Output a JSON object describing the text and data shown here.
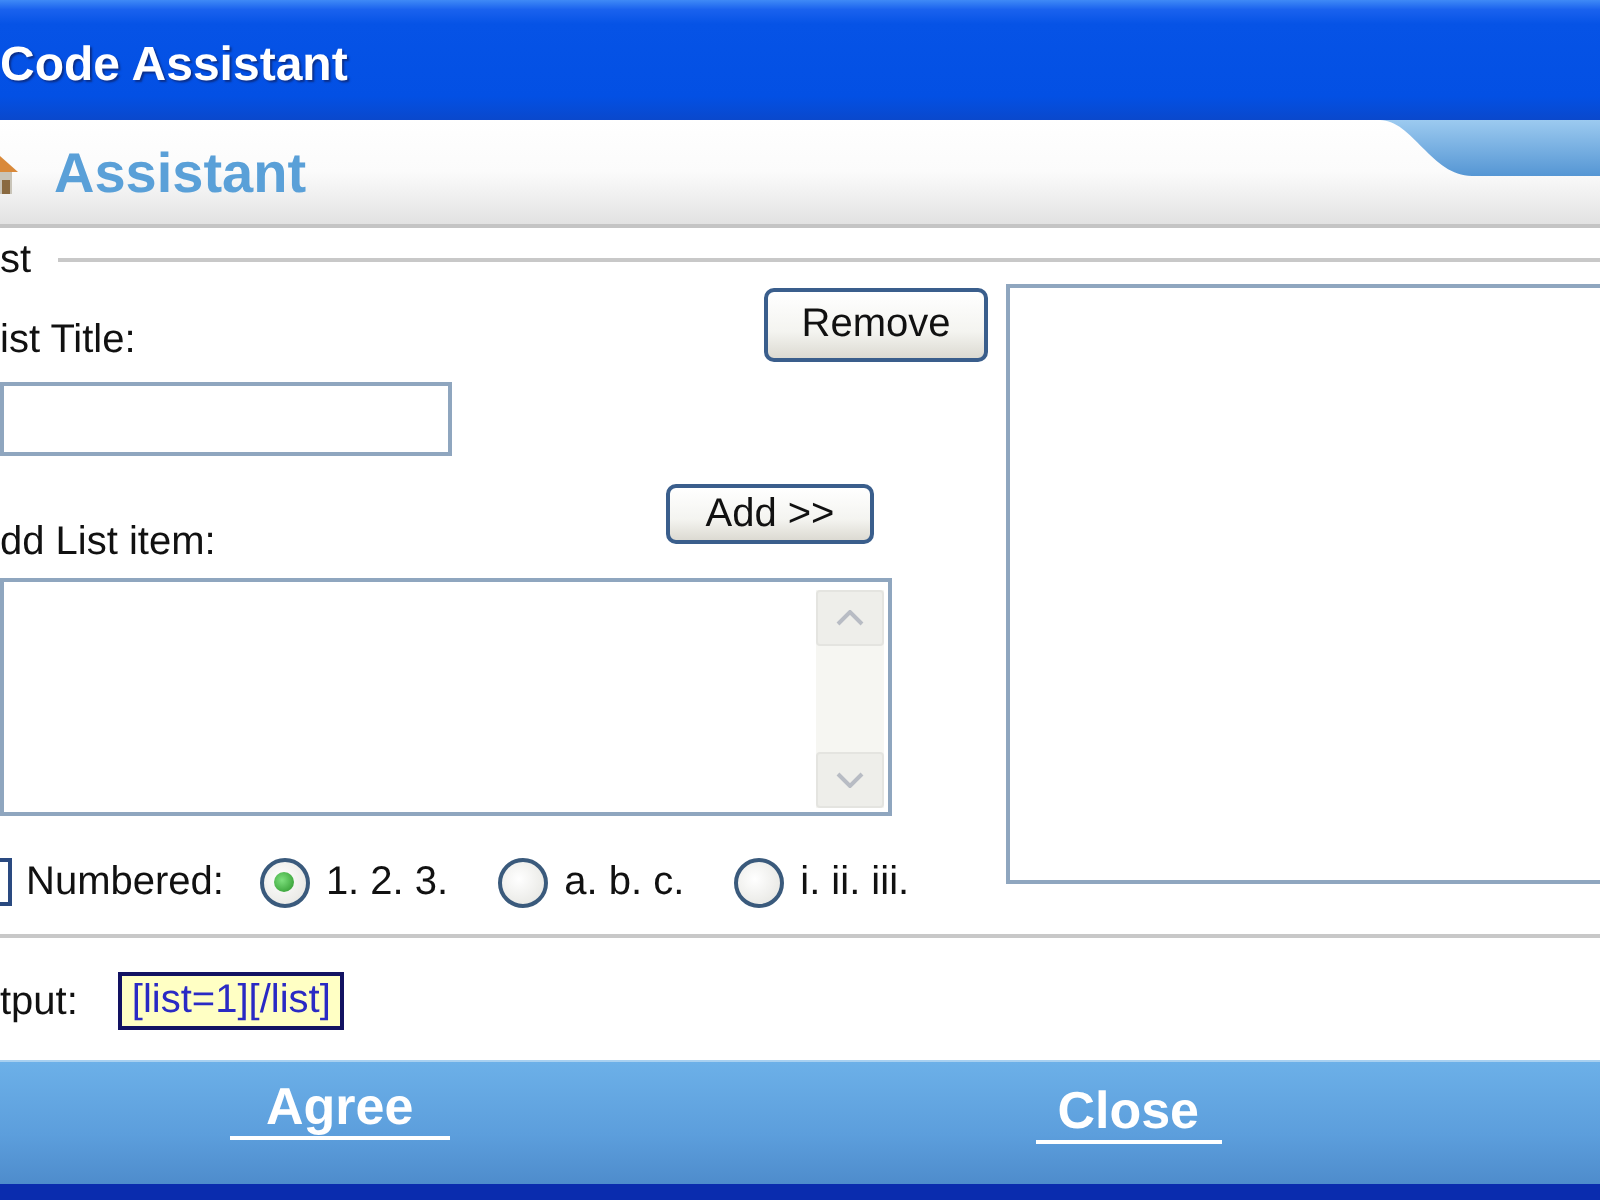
{
  "window": {
    "title": "Code Assistant"
  },
  "header": {
    "title": "Assistant"
  },
  "list_group": {
    "legend": "st",
    "title_label": "ist Title:",
    "remove_button": "Remove",
    "item_label": "dd List item:",
    "add_button": "Add >>",
    "numbered": {
      "label": "Numbered:",
      "checked": false,
      "styles": [
        {
          "label": "1. 2. 3.",
          "selected": true
        },
        {
          "label": "a. b. c.",
          "selected": false
        },
        {
          "label": "i. ii. iii.",
          "selected": false
        }
      ]
    }
  },
  "output": {
    "label": "tput:",
    "value": "[list=1][/list]"
  },
  "buttons": [
    "Agree",
    "Close"
  ]
}
